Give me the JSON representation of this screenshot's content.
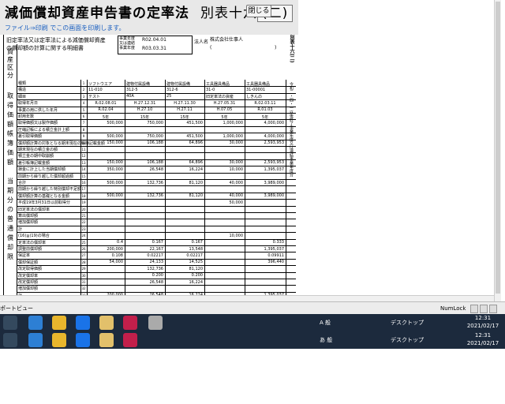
{
  "window": {
    "title": "減価償却資産申告書の定率法",
    "sheet": "別表十六",
    "sheet_part": "(二)",
    "close_label": "閉じる"
  },
  "menu": {
    "file": "ファイル",
    "print": "印刷",
    "hint": "でこの画面を印刷します。"
  },
  "doc": {
    "subject_line1": "旧定率法又は定率法による減価償却資産",
    "subject_line2": "の償却額の計算に関する明細書",
    "period_label1": "事業年度",
    "period_label2": "又は連結",
    "period_label3": "事業年度",
    "period_from": "R02.04.01",
    "period_to": "R03.03.31",
    "corp_label": "法人名",
    "corp_name": "株式会社仕事人",
    "corp_paren_open": "(",
    "corp_paren_close": ")",
    "right_vertical": "別表十六(二)",
    "right_vertical2": "令和二・四・一以後終了事業年度又は連結事業年度分"
  },
  "side": {
    "asset_cat": [
      "資",
      "産",
      "区",
      "分"
    ],
    "acq": [
      "取",
      "得",
      "価",
      "額"
    ],
    "book": [
      "帳",
      "簿",
      "価",
      "額"
    ],
    "cur": [
      "当",
      "期",
      "分",
      "の",
      "普",
      "通",
      "償",
      "却",
      "限",
      "度",
      "額",
      "等"
    ],
    "last": [
      "償",
      "却",
      "額",
      "計",
      "算"
    ]
  },
  "rows": [
    {
      "label": "種類",
      "no": "1",
      "c1": "ソフトウエア",
      "c2": "建物付属設備",
      "c3": "建物付属設備",
      "c4": "工具器具備品",
      "c5": "工具器具備品"
    },
    {
      "label": "構造",
      "no": "2",
      "c1": "11-010",
      "c2": "312-5",
      "c3": "312-6",
      "c4": "31-0",
      "c5": "31-00001"
    },
    {
      "label": "細目",
      "no": "3",
      "c1": "テスト",
      "c2": "40A",
      "c3": "25",
      "c4": "旧定率法の資産",
      "c5": "しきんの"
    },
    {
      "label": "取得年月日",
      "no": "4",
      "c1": "R.02.08.01",
      "c2": "H.27.12.31",
      "c3": "H.27.11.30",
      "c4": "H.27.05.31",
      "c5": "R.02.03.11"
    },
    {
      "label": "事業の用に供した年月",
      "no": "5",
      "c1": "R.02.04",
      "c2": "H.27.10",
      "c3": "H.27.11",
      "c4": "H.07.05",
      "c5": "R.01.03"
    },
    {
      "label": "耐用年数",
      "no": "6",
      "c1": "5年",
      "c2": "15年",
      "c3": "15年",
      "c4": "5年",
      "c5": "5年"
    },
    {
      "label": "取得価額又は製作価額",
      "no": "7",
      "c1": "500,000",
      "c2": "750,000",
      "c3": "451,500",
      "c4": "1,000,000",
      "c5": "4,000,000"
    },
    {
      "label": "圧縮記帳による積立金計上額",
      "no": "8",
      "c1": "",
      "c2": "",
      "c3": "",
      "c4": "",
      "c5": ""
    },
    {
      "label": "差引取得価額",
      "no": "9",
      "c1": "500,000",
      "c2": "750,000",
      "c3": "451,500",
      "c4": "1,000,000",
      "c5": "4,000,000"
    },
    {
      "label": "償却額計算の対象となる期末現在の帳簿記載金額",
      "no": "10",
      "c1": "150,000",
      "c2": "106,188",
      "c3": "64,896",
      "c4": "30,000",
      "c5": "2,593,953"
    },
    {
      "label": "期末現在の積立金の額",
      "no": "11",
      "c1": "",
      "c2": "",
      "c3": "",
      "c4": "",
      "c5": ""
    },
    {
      "label": "積立金の期中取崩額",
      "no": "12",
      "c1": "",
      "c2": "",
      "c3": "",
      "c4": "",
      "c5": ""
    },
    {
      "label": "差引帳簿記載金額",
      "no": "13",
      "c1": "150,000",
      "c2": "106,188",
      "c3": "64,896",
      "c4": "30,000",
      "c5": "2,593,953"
    },
    {
      "label": "損金に計上した当期償却額",
      "no": "14",
      "c1": "350,000",
      "c2": "26,548",
      "c3": "16,224",
      "c4": "10,000",
      "c5": "1,395,037"
    },
    {
      "label": "前期から繰り越した償却超過額",
      "no": "15",
      "c1": "",
      "c2": "",
      "c3": "",
      "c4": "",
      "c5": ""
    },
    {
      "label": "合計",
      "no": "16",
      "c1": "500,000",
      "c2": "132,736",
      "c3": "81,120",
      "c4": "40,000",
      "c5": "3,989,000"
    },
    {
      "label": "前期から繰り越した特別償却不足額",
      "no": "17",
      "c1": "",
      "c2": "",
      "c3": "",
      "c4": "",
      "c5": ""
    },
    {
      "label": "償却額計算の基礎となる金額",
      "no": "18",
      "c1": "500,000",
      "c2": "132,736",
      "c3": "81,120",
      "c4": "40,000",
      "c5": "3,989,000"
    },
    {
      "label": "平成19年3月31日以前取得分",
      "no": "19",
      "c1": "",
      "c2": "",
      "c3": "",
      "c4": "50,000",
      "c5": ""
    },
    {
      "label": "旧定率法の償却率",
      "no": "20",
      "c1": "",
      "c2": "",
      "c3": "",
      "c4": "",
      "c5": ""
    },
    {
      "label": "算出償却額",
      "no": "21",
      "c1": "",
      "c2": "",
      "c3": "",
      "c4": "",
      "c5": ""
    },
    {
      "label": "増加償却額",
      "no": "22",
      "c1": "",
      "c2": "",
      "c3": "",
      "c4": "",
      "c5": ""
    },
    {
      "label": "計",
      "no": "23",
      "c1": "",
      "c2": "",
      "c3": "",
      "c4": "",
      "c5": ""
    },
    {
      "label": "(16)≦(19)の場合",
      "no": "24",
      "c1": "",
      "c2": "",
      "c3": "",
      "c4": "10,000",
      "c5": ""
    },
    {
      "label": "定率法の償却率",
      "no": "25",
      "c1": "0.4",
      "c2": "0.167",
      "c3": "0.167",
      "c4": "",
      "c5": "0.333"
    },
    {
      "label": "調整前償却額",
      "no": "26",
      "c1": "200,000",
      "c2": "22,167",
      "c3": "13,548",
      "c4": "",
      "c5": "1,395,037"
    },
    {
      "label": "保証率",
      "no": "27",
      "c1": "0.108",
      "c2": "0.02217",
      "c3": "0.02217",
      "c4": "",
      "c5": "0.09911"
    },
    {
      "label": "償却保証額",
      "no": "28",
      "c1": "54,000",
      "c2": "24,133",
      "c3": "14,525",
      "c4": "",
      "c5": "396,440"
    },
    {
      "label": "改定取得価額",
      "no": "29",
      "c1": "",
      "c2": "132,736",
      "c3": "81,120",
      "c4": "",
      "c5": ""
    },
    {
      "label": "改定償却率",
      "no": "30",
      "c1": "",
      "c2": "0.200",
      "c3": "0.200",
      "c4": "",
      "c5": ""
    },
    {
      "label": "改定償却額",
      "no": "31",
      "c1": "",
      "c2": "26,548",
      "c3": "16,224",
      "c4": "",
      "c5": ""
    },
    {
      "label": "増加償却額",
      "no": "32",
      "c1": "",
      "c2": "",
      "c3": "",
      "c4": "",
      "c5": ""
    },
    {
      "label": "計",
      "no": "33",
      "c1": "200,000",
      "c2": "26,548",
      "c3": "16,224",
      "c4": "",
      "c5": "1,395,037"
    }
  ],
  "status": {
    "left": "ポートビュー",
    "numlock": "NumLock"
  },
  "taskbar": {
    "desktop": "デスクトップ",
    "time": "12:31",
    "date": "2021/02/17",
    "ime": "A 般",
    "ime2": "あ 般"
  }
}
